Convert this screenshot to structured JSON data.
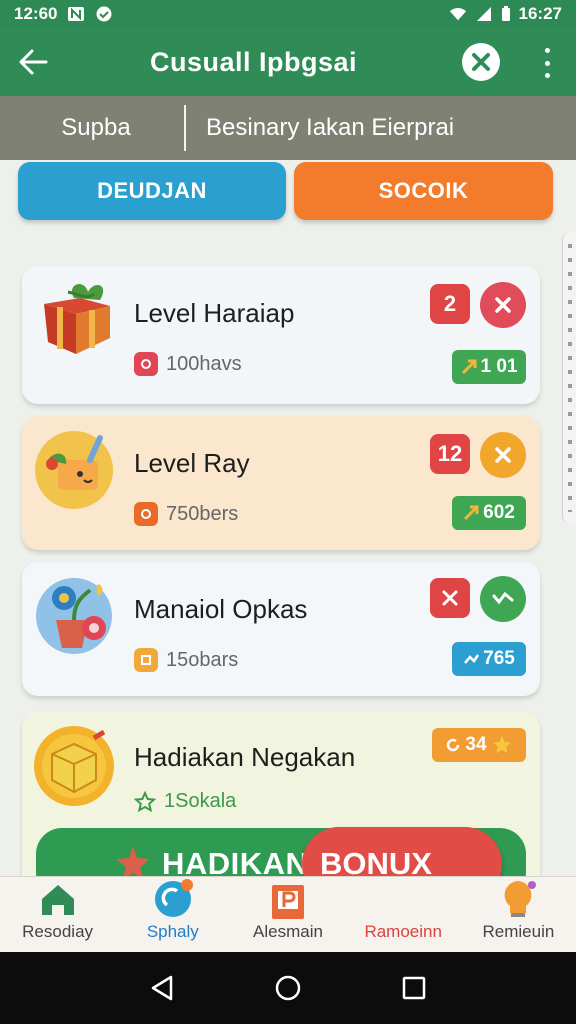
{
  "status": {
    "time_left": "12:60",
    "time_right": "16:27",
    "colors": {
      "bar": "#2e8a55"
    }
  },
  "appbar": {
    "title": "Cusuall Ipbgsai",
    "back_icon": "arrow-left-icon",
    "close_icon": "close-icon",
    "menu_icon": "more-vert-icon"
  },
  "subbar": {
    "left": "Supba",
    "right": "Besinary Iakan Eierprai"
  },
  "buttons": {
    "left": "DEUDJAN",
    "right": "SOCOIK"
  },
  "cards": [
    {
      "title": "Level Haraiap",
      "sub": "100havs",
      "badge": "2",
      "pill": "1 01",
      "art": "gift-box-icon"
    },
    {
      "title": "Level Ray",
      "sub": "750bers",
      "badge": "12",
      "pill": "602",
      "art": "cart-mascot-icon"
    },
    {
      "title": "Manaiol Opkas",
      "sub": "15obars",
      "badge": "",
      "pill": "765",
      "art": "flower-pot-icon"
    },
    {
      "title": "Hadiakan Negakan",
      "sub": "1Sokala",
      "badge": "34",
      "art": "golden-chest-icon"
    }
  ],
  "bonus": {
    "left_label": "HADIKAN",
    "right_label": "BONUX"
  },
  "nav": [
    {
      "label": "Resodiay",
      "icon": "home-icon"
    },
    {
      "label": "Sphaly",
      "icon": "spin-icon"
    },
    {
      "label": "Alesmain",
      "icon": "tag-icon"
    },
    {
      "label": "Ramoeinn",
      "icon": "gift-icon"
    },
    {
      "label": "Remieuin",
      "icon": "bulb-icon"
    }
  ],
  "colors": {
    "green": "#2f8c57",
    "blue": "#2a9fd0",
    "orange": "#f27b2c",
    "red": "#e14c47"
  }
}
